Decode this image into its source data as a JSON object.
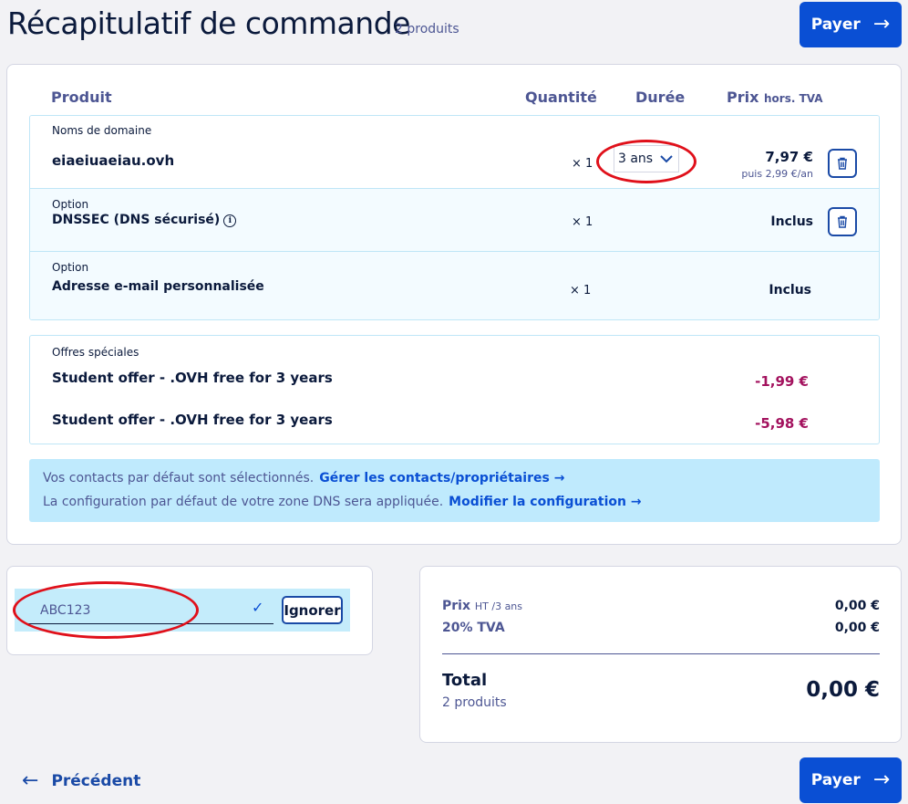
{
  "header": {
    "title": "Récapitulatif de commande",
    "product_count": "2 produits",
    "pay_label": "Payer"
  },
  "table": {
    "col_product": "Produit",
    "col_quantity": "Quantité",
    "col_duration": "Durée",
    "col_price": "Prix",
    "col_price_suffix": "hors. TVA"
  },
  "items": [
    {
      "category": "Noms de domaine",
      "name": "eiaeiuaeiau.ovh",
      "quantity": "× 1",
      "duration": "3 ans",
      "price": "7,97 €",
      "subprice": "puis 2,99 €/an"
    },
    {
      "category": "Option",
      "name": "DNSSEC (DNS sécurisé)",
      "quantity": "× 1",
      "price": "Inclus"
    },
    {
      "category": "Option",
      "name": "Adresse e-mail personnalisée",
      "quantity": "× 1",
      "price": "Inclus"
    }
  ],
  "offers": {
    "title": "Offres spéciales",
    "list": [
      {
        "name": "Student offer - .OVH free for 3 years",
        "price": "-1,99 €"
      },
      {
        "name": "Student offer - .OVH free for 3 years",
        "price": "-5,98 €"
      }
    ]
  },
  "notice": {
    "line1": "Vos contacts par défaut sont sélectionnés.",
    "link1": "Gérer les contacts/propriétaires",
    "line2": "La configuration par défaut de votre zone DNS sera appliquée.",
    "link2": "Modifier la configuration"
  },
  "promo": {
    "value": "ABC123",
    "ignore_label": "Ignorer"
  },
  "summary": {
    "price_label": "Prix",
    "price_suffix": "HT /3 ans",
    "price_value": "0,00 €",
    "tax_label": "20% TVA",
    "tax_value": "0,00 €",
    "total_label": "Total",
    "total_sub": "2 produits",
    "total_value": "0,00 €"
  },
  "footer": {
    "previous_label": "Précédent",
    "pay_label": "Payer"
  },
  "colors": {
    "accent": "#0a4fd4",
    "discount": "#a3125e",
    "notice_bg": "#bfeafd",
    "annotation": "#e0101a"
  },
  "icons": [
    "arrow-right-icon",
    "arrow-left-icon",
    "chevron-down-icon",
    "trash-icon",
    "info-icon",
    "check-icon"
  ]
}
